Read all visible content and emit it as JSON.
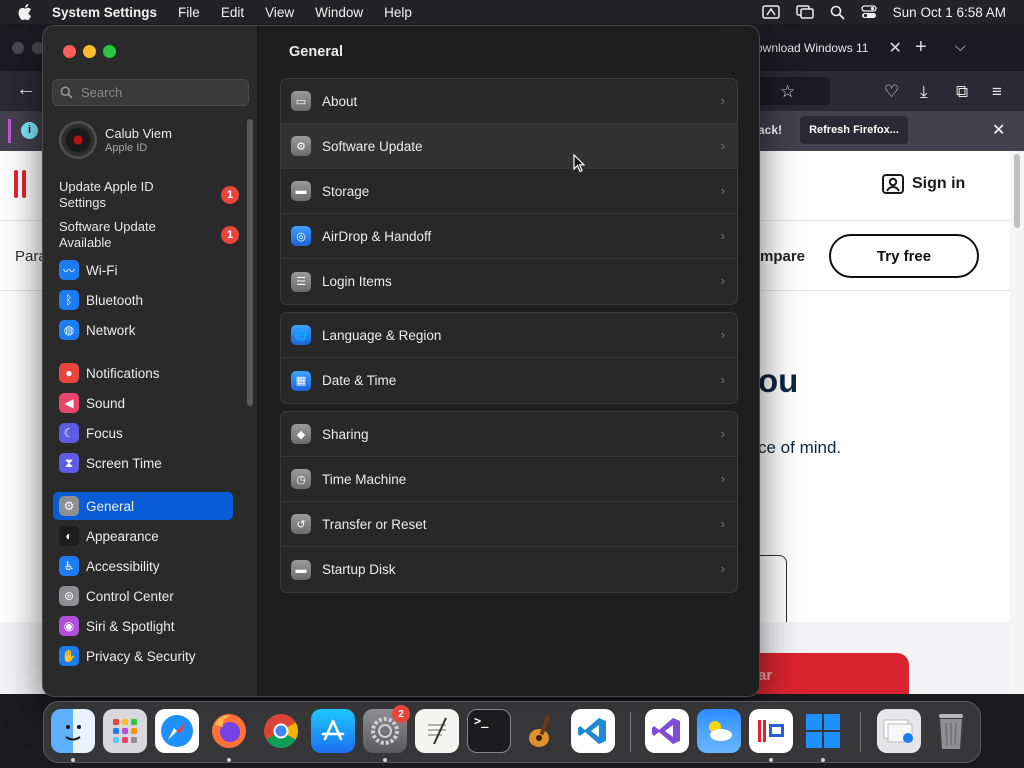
{
  "menubar": {
    "app_name": "System Settings",
    "menus": [
      "File",
      "Edit",
      "View",
      "Window",
      "Help"
    ],
    "clock": "Sun Oct 1  6:58 AM"
  },
  "browser": {
    "tab_title": "ownload Windows 11",
    "notification_text": "ack!",
    "notification_button": "Refresh Firefox...",
    "sign_in": "Sign in",
    "nav_fragment_left": "Para",
    "nav_fragment_right": "mpare",
    "try_free": "Try free",
    "hero_fragment": "ou",
    "hero_sub_fragment": "ce of mind.",
    "red_button_fragment": "ar"
  },
  "settings": {
    "search_placeholder": "Search",
    "account": {
      "name": "Calub Viem",
      "subtitle": "Apple ID"
    },
    "alerts": [
      {
        "label": "Update Apple ID Settings",
        "badge": "1"
      },
      {
        "label": "Software Update Available",
        "badge": "1"
      }
    ],
    "sidebar_items": [
      {
        "label": "Wi-Fi",
        "icon": "wifi-icon",
        "color": "#1e7cf2"
      },
      {
        "label": "Bluetooth",
        "icon": "bluetooth-icon",
        "color": "#1e7cf2"
      },
      {
        "label": "Network",
        "icon": "network-icon",
        "color": "#1e7cf2"
      },
      {
        "label": "Notifications",
        "icon": "bell-icon",
        "color": "#e8453c"
      },
      {
        "label": "Sound",
        "icon": "speaker-icon",
        "color": "#e8456a"
      },
      {
        "label": "Focus",
        "icon": "moon-icon",
        "color": "#5e5ce6"
      },
      {
        "label": "Screen Time",
        "icon": "hourglass-icon",
        "color": "#5e5ce6"
      },
      {
        "label": "General",
        "icon": "gear-icon",
        "color": "#8e8e93"
      },
      {
        "label": "Appearance",
        "icon": "appearance-icon",
        "color": "#1c1c1e"
      },
      {
        "label": "Accessibility",
        "icon": "accessibility-icon",
        "color": "#1e7cf2"
      },
      {
        "label": "Control Center",
        "icon": "toggles-icon",
        "color": "#8e8e93"
      },
      {
        "label": "Siri & Spotlight",
        "icon": "siri-icon",
        "color": "#b04fd9"
      },
      {
        "label": "Privacy & Security",
        "icon": "hand-icon",
        "color": "#1e7cf2"
      }
    ],
    "selected_item": "General",
    "main_title": "General",
    "groups": [
      [
        {
          "label": "About",
          "icon": "display-icon"
        },
        {
          "label": "Software Update",
          "icon": "gear-badge-icon"
        },
        {
          "label": "Storage",
          "icon": "drive-icon"
        },
        {
          "label": "AirDrop & Handoff",
          "icon": "airdrop-icon"
        },
        {
          "label": "Login Items",
          "icon": "list-icon"
        }
      ],
      [
        {
          "label": "Language & Region",
          "icon": "globe-icon"
        },
        {
          "label": "Date & Time",
          "icon": "calendar-icon"
        }
      ],
      [
        {
          "label": "Sharing",
          "icon": "sharing-icon"
        },
        {
          "label": "Time Machine",
          "icon": "time-machine-icon"
        },
        {
          "label": "Transfer or Reset",
          "icon": "reset-icon"
        },
        {
          "label": "Startup Disk",
          "icon": "disk-icon"
        }
      ]
    ]
  },
  "dock": {
    "apps": [
      "finder-icon",
      "launchpad-icon",
      "safari-icon",
      "firefox-icon",
      "chrome-icon",
      "app-store-icon",
      "system-settings-icon",
      "textedit-icon",
      "terminal-icon",
      "garageband-icon",
      "vscode-icon",
      "visual-studio-icon",
      "weather-icon",
      "parallels-icon",
      "windows-icon",
      "downloads-stack-icon",
      "trash-icon"
    ],
    "settings_badge": "2"
  }
}
